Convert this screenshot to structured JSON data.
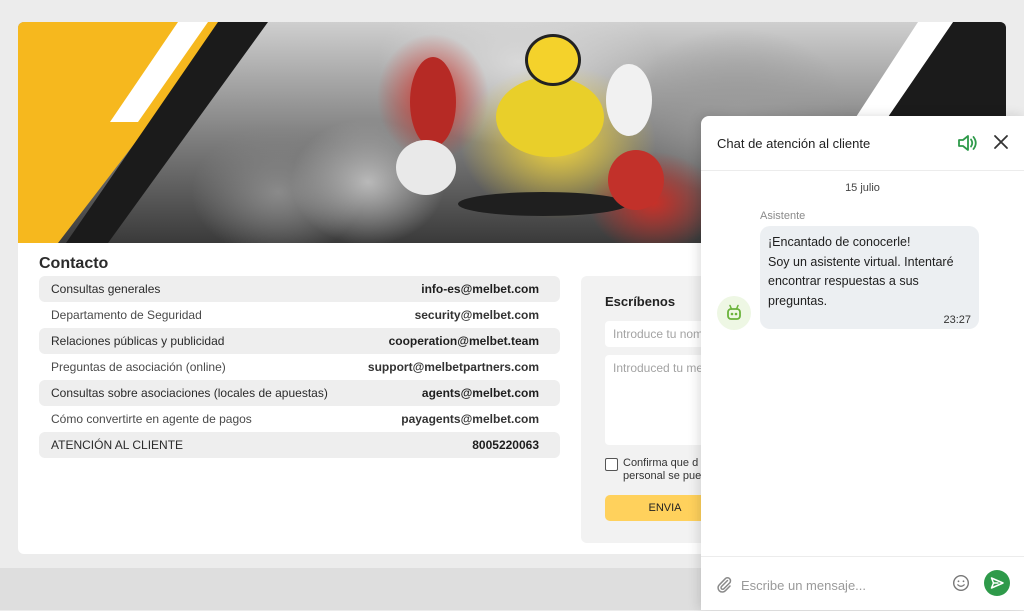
{
  "contact": {
    "title": "Contacto",
    "rows": [
      {
        "name": "Consultas generales",
        "value": "info-es@melbet.com"
      },
      {
        "name": "Departamento de Seguridad",
        "value": "security@melbet.com"
      },
      {
        "name": "Relaciones públicas y publicidad",
        "value": "cooperation@melbet.team"
      },
      {
        "name": "Preguntas de asociación (online)",
        "value": "support@melbetpartners.com"
      },
      {
        "name": "Consultas sobre asociaciones (locales de apuestas)",
        "value": "agents@melbet.com"
      },
      {
        "name": "Cómo convertirte en agente de pagos",
        "value": "payagents@melbet.com"
      },
      {
        "name": "ATENCIÓN AL CLIENTE",
        "value": "8005220063"
      }
    ]
  },
  "write": {
    "title": "Escríbenos",
    "name_placeholder": "Introduce tu nom",
    "message_placeholder": "Introduced tu me",
    "consent_text": "Confirma que d\npersonal se pue",
    "send_label": "ENVIA"
  },
  "chat": {
    "title": "Chat de atención al cliente",
    "date": "15 julio",
    "sender": "Asistente",
    "message": "¡Encantado de conocerle!\nSoy un asistente virtual. Intentaré encontrar respuestas a sus preguntas.",
    "time": "23:27",
    "input_placeholder": "Escribe un mensaje..."
  },
  "colors": {
    "brand_yellow": "#f6b81e",
    "accent_green": "#2e9a4a",
    "button_yellow": "#ffd15c"
  }
}
